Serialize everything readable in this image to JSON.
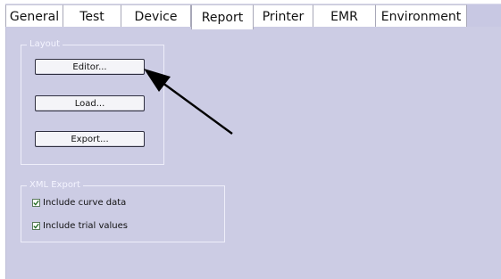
{
  "tabs": [
    {
      "label": "General"
    },
    {
      "label": "Test"
    },
    {
      "label": "Device"
    },
    {
      "label": "Report",
      "active": true
    },
    {
      "label": "Printer"
    },
    {
      "label": "EMR"
    },
    {
      "label": "Environment"
    }
  ],
  "layout_group": {
    "title": "Layout",
    "editor_label": "Editor...",
    "load_label": "Load...",
    "export_label": "Export..."
  },
  "xml_export_group": {
    "title": "XML Export",
    "include_curve_label": "Include curve data",
    "include_curve_checked": true,
    "include_trial_label": "Include trial values",
    "include_trial_checked": true
  },
  "annotation": {
    "icon": "arrow-pointer-icon"
  },
  "colors": {
    "panel": "#cccce4",
    "tab_strip": "#c8c8e3",
    "group_text": "#f4f4ff"
  }
}
